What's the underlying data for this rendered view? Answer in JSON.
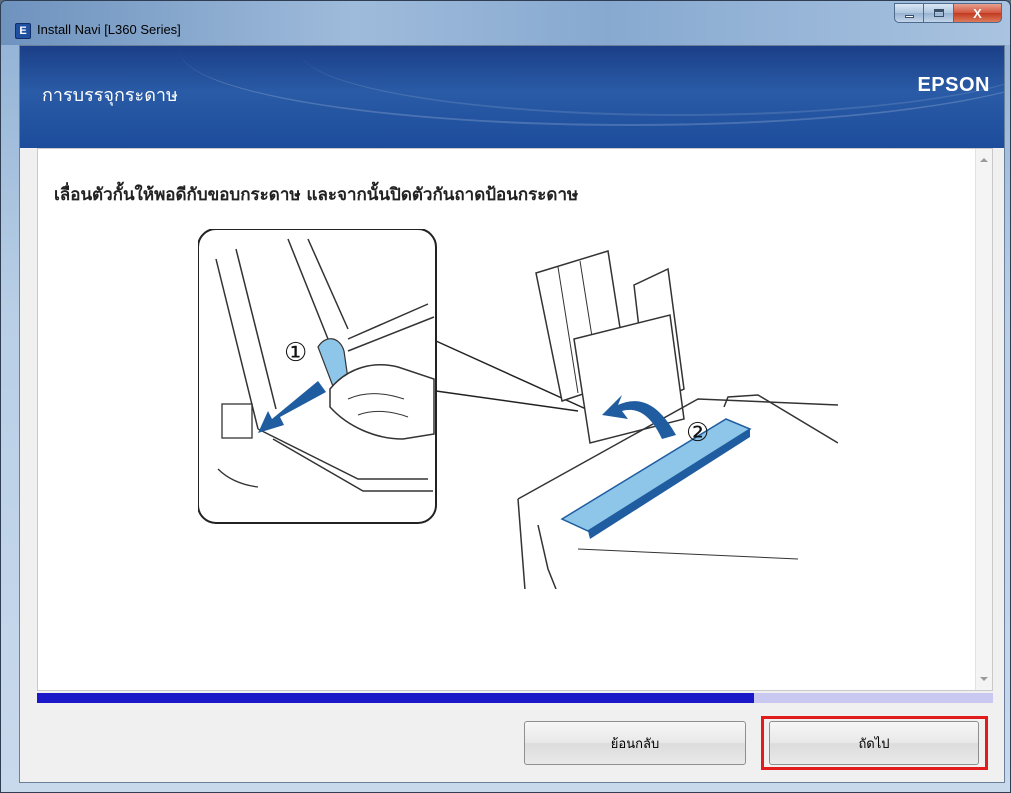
{
  "window": {
    "title": "Install Navi [L360 Series]",
    "app_icon_letter": "E",
    "close_glyph": "X"
  },
  "header": {
    "title": "การบรรจุกระดาษ",
    "brand": "EPSON"
  },
  "content": {
    "instruction": "เลื่อนตัวกั้นให้พอดีกับขอบกระดาษ และจากนั้นปิดตัวกันถาดป้อนกระดาษ",
    "step_markers": [
      "①",
      "②"
    ]
  },
  "progress": {
    "value_fraction": 0.75
  },
  "buttons": {
    "back_label": "ย้อนกลับ",
    "next_label": "ถัดไป"
  },
  "colors": {
    "header_blue": "#1c4c9b",
    "progress_fill": "#1a18c8",
    "illustration_blue": "#1f5da0",
    "guide_light_blue": "#8ec6ea",
    "highlight_red": "#e21c1c"
  }
}
